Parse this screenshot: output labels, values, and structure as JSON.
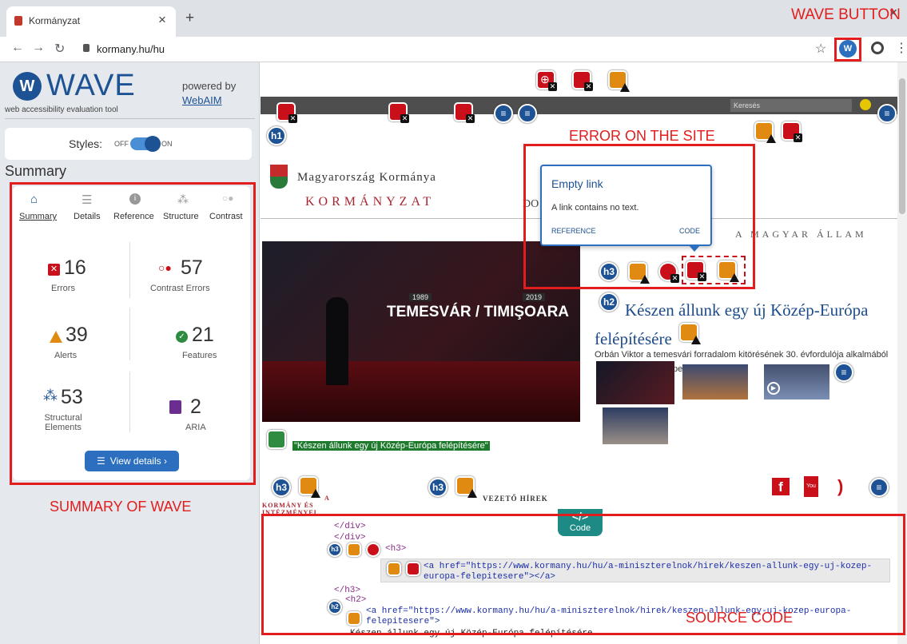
{
  "browser": {
    "tab_title": "Kormányzat",
    "tab_close": "×",
    "new_tab": "+",
    "url": "kormany.hu/hu"
  },
  "wave": {
    "logo": "WAVE",
    "tagline": "web accessibility evaluation tool",
    "powered_by": "powered by",
    "webaim": "WebAIM",
    "styles_label": "Styles:",
    "styles_off": "OFF",
    "styles_on": "ON",
    "summary_heading": "Summary",
    "tabs": [
      {
        "label": "Summary"
      },
      {
        "label": "Details"
      },
      {
        "label": "Reference"
      },
      {
        "label": "Structure"
      },
      {
        "label": "Contrast"
      }
    ],
    "stats": {
      "errors": {
        "value": "16",
        "label": "Errors"
      },
      "contrast": {
        "value": "57",
        "label": "Contrast Errors"
      },
      "alerts": {
        "value": "39",
        "label": "Alerts"
      },
      "features": {
        "value": "21",
        "label": "Features"
      },
      "structural": {
        "value": "53",
        "label": "Structural Elements"
      },
      "aria": {
        "value": "2",
        "label": "ARIA"
      }
    },
    "view_details": "View details ›"
  },
  "annotations": {
    "wave_button": "WAVE BUTTON",
    "error_on_site": "ERROR ON THE SITE",
    "summary_of_wave": "SUMMARY OF WAVE",
    "source_code": "SOURCE CODE"
  },
  "site": {
    "search_placeholder": "Keresés",
    "gov_title": "Magyarország Kormánya",
    "gov_subtitle": "KORMÁNYZAT",
    "magyar_allam": "A MAGYAR ÁLLAM",
    "hero_years_left": "1989",
    "hero_years_right": "2019",
    "hero_caption": "TEMESVÁR / TIMIŞOARA",
    "headline": "Készen állunk egy új Közép-Európa felépítésére",
    "summary": "Orbán Viktor a temesvári forradalom kitörésének 30. évfordulója alkalmából",
    "summary_tail": "pe",
    "link_label": "\"Készen állunk egy új Közép-Európa felépítésére\"",
    "h3_left": "A KORMÁNY ÉS INTÉZMÉNYEI",
    "h3_right": "VEZETŐ HÍREK"
  },
  "tooltip": {
    "title": "Empty link",
    "body": "A link contains no text.",
    "reference": "REFERENCE",
    "code": "CODE"
  },
  "code_panel": {
    "toggle": "Code",
    "lines": [
      "</div>",
      "</div>",
      "<h3>",
      "<a href=\"https://www.kormany.hu/hu/a-miniszterelnok/hirek/keszen-allunk-egy-uj-kozep-",
      "europa-felepitesere\"></a>",
      "</h3>",
      "<h2>",
      "<a href=\"https://www.kormany.hu/hu/a-miniszterelnok/hirek/keszen-allunk-egy-uj-kozep-europa-",
      "felepitesere\">",
      "Készen állunk egy új Közép-Európa felépítésére"
    ]
  },
  "colors": {
    "wave_blue": "#1d5294",
    "error_red": "#c9101a",
    "alert_orange": "#e08a12",
    "annotation_red": "#e21d1d",
    "gov_red": "#a8242f"
  }
}
